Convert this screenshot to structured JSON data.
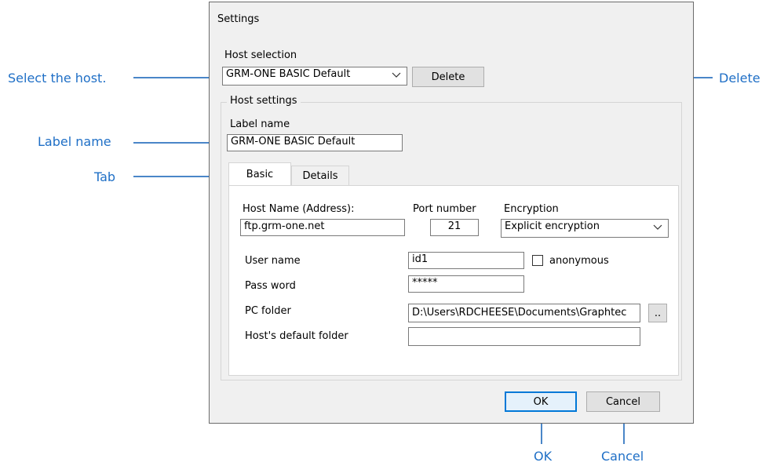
{
  "dialog": {
    "title": "Settings",
    "host_selection_label": "Host selection",
    "host_selection_value": "GRM-ONE BASIC Default",
    "delete_button": "Delete",
    "host_settings_group": "Host settings",
    "label_name_label": "Label name",
    "label_name_value": "GRM-ONE BASIC Default",
    "tabs": [
      {
        "label": "Basic"
      },
      {
        "label": "Details"
      }
    ],
    "basic": {
      "host_name_label": "Host Name (Address):",
      "host_name_value": "ftp.grm-one.net",
      "port_label": "Port number",
      "port_value": "21",
      "encryption_label": "Encryption",
      "encryption_value": "Explicit encryption",
      "user_name_label": "User name",
      "user_name_value": "id1",
      "anonymous_label": "anonymous",
      "password_label": "Pass word",
      "password_value": "*****",
      "pc_folder_label": "PC folder",
      "pc_folder_value": "D:\\Users\\RDCHEESE\\Documents\\Graphtec",
      "browse_button": "..",
      "host_default_folder_label": "Host's default folder",
      "host_default_folder_value": ""
    },
    "ok_button": "OK",
    "cancel_button": "Cancel"
  },
  "callouts": {
    "select_host": "Select the host.",
    "delete": "Delete",
    "label_name": "Label name",
    "tab": "Tab",
    "ok": "OK",
    "cancel": "Cancel"
  },
  "colors": {
    "callout": "#1f6fc6",
    "accent": "#0078d7"
  }
}
